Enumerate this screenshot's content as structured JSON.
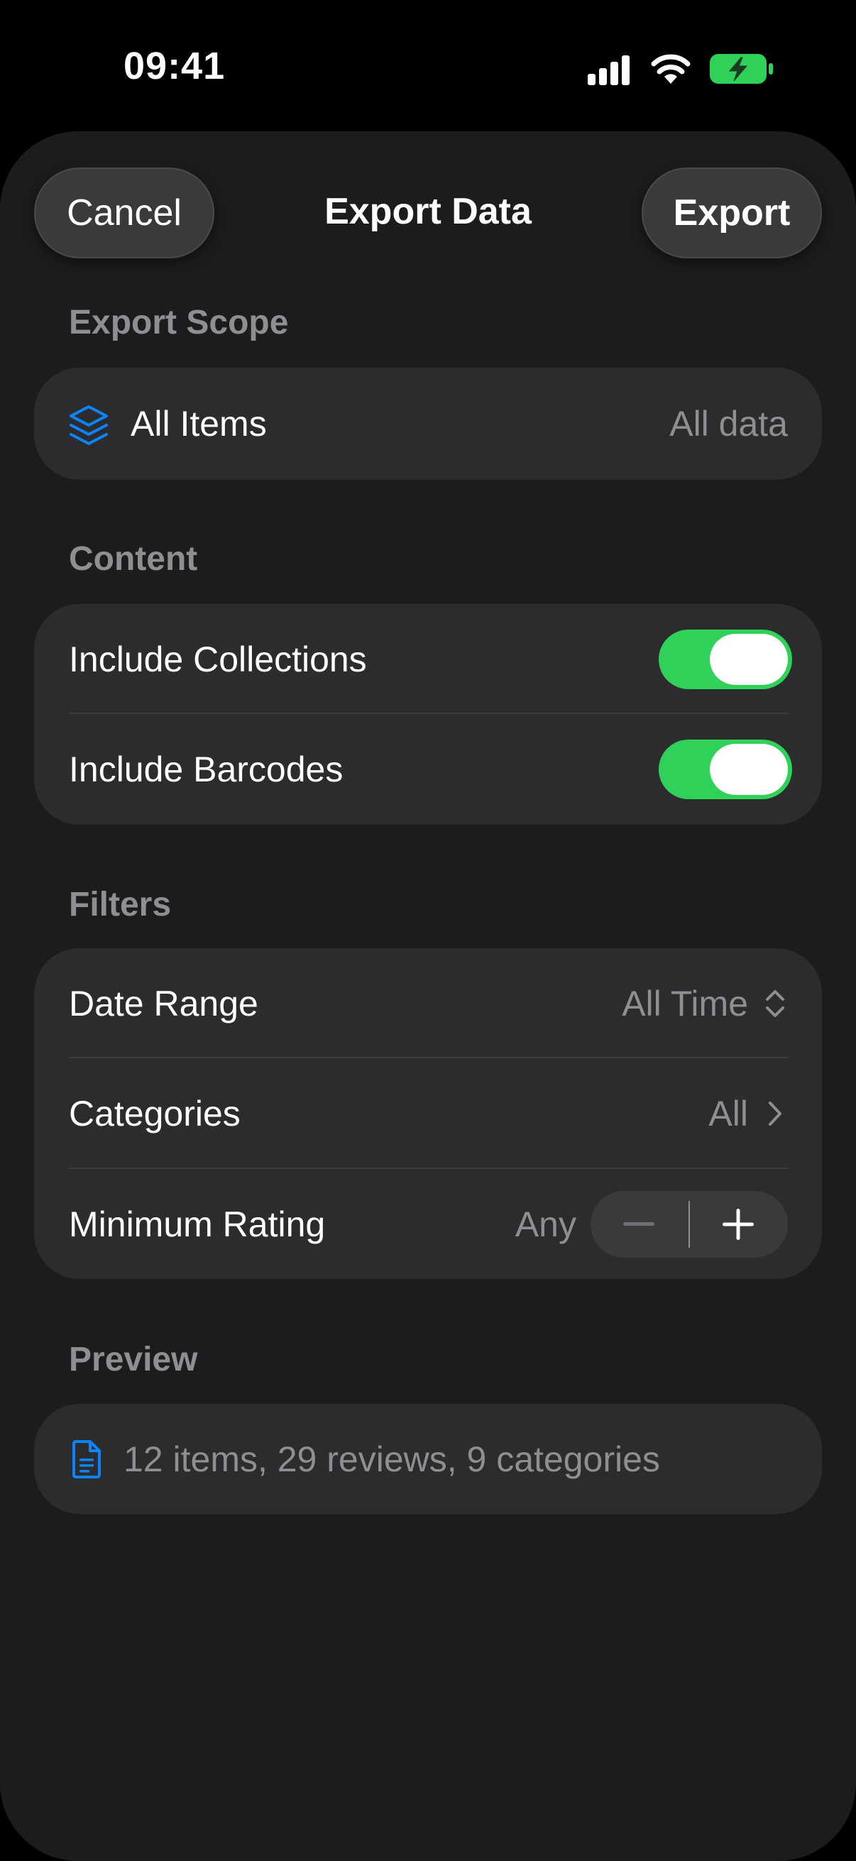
{
  "status_bar": {
    "time": "09:41"
  },
  "nav": {
    "cancel_label": "Cancel",
    "title": "Export Data",
    "export_label": "Export"
  },
  "export_scope": {
    "header": "Export Scope",
    "item_label": "All Items",
    "item_value": "All data",
    "item_icon": "stack-icon"
  },
  "content": {
    "header": "Content",
    "rows": [
      {
        "label": "Include Collections",
        "on": true
      },
      {
        "label": "Include Barcodes",
        "on": true
      }
    ]
  },
  "filters": {
    "header": "Filters",
    "date_range": {
      "label": "Date Range",
      "value": "All Time"
    },
    "categories": {
      "label": "Categories",
      "value": "All"
    },
    "minimum_rating": {
      "label": "Minimum Rating",
      "value": "Any"
    }
  },
  "preview": {
    "header": "Preview",
    "summary": "12 items, 29 reviews, 9 categories",
    "icon": "document-icon"
  },
  "colors": {
    "accent_blue": "#0a84ff",
    "toggle_green": "#30d158",
    "battery_green": "#30d158",
    "card_bg": "#2c2c2e",
    "sheet_bg": "#1c1c1e",
    "secondary_text": "#8e8e93"
  }
}
